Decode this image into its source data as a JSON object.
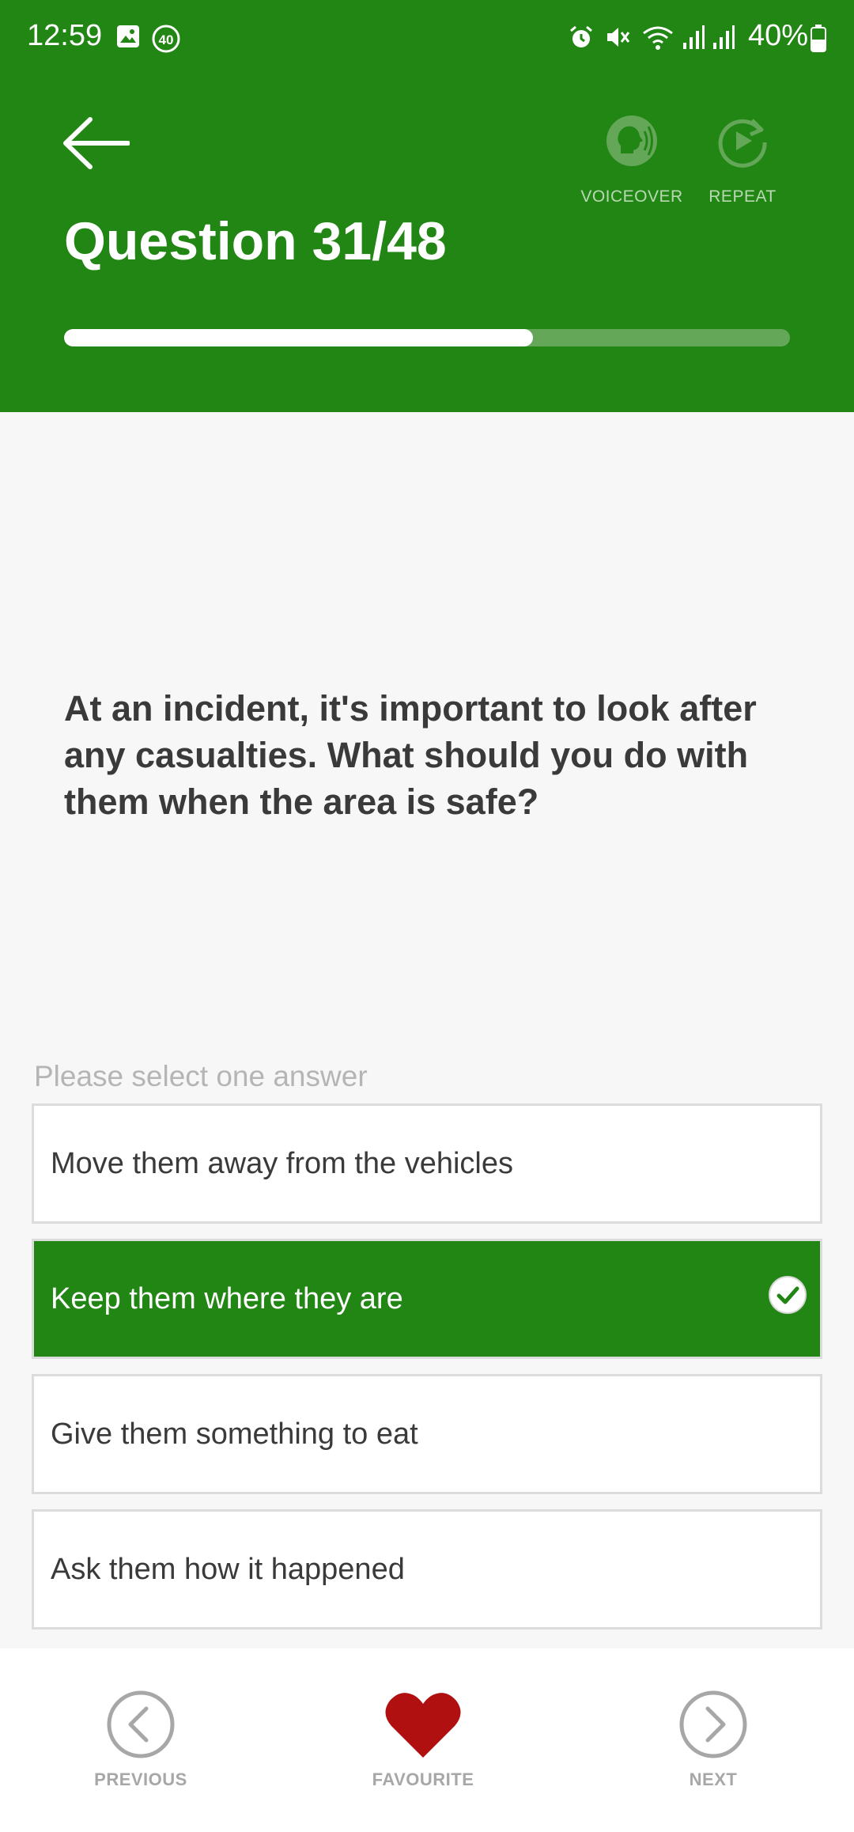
{
  "status_bar": {
    "time": "12:59",
    "battery": "40%"
  },
  "header": {
    "title": "Question 31/48",
    "voiceover_label": "VOICEOVER",
    "repeat_label": "REPEAT",
    "progress": {
      "current": 31,
      "total": 48
    }
  },
  "question": {
    "text": "At an incident, it's important to look after any casualties. What should you do with them when the area is safe?"
  },
  "prompt": "Please select one answer",
  "answers": [
    {
      "label": "Move them away from the vehicles",
      "selected": false
    },
    {
      "label": "Keep them where they are",
      "selected": true
    },
    {
      "label": "Give them something to eat",
      "selected": false
    },
    {
      "label": "Ask them how it happened",
      "selected": false
    }
  ],
  "bottom_nav": {
    "previous": "PREVIOUS",
    "favourite": "FAVOURITE",
    "next": "NEXT"
  },
  "colors": {
    "brand_green": "#228614",
    "favourite_red": "#b01010",
    "progress_track": "#64a758"
  },
  "icons": [
    "image-icon",
    "notification-badge-icon",
    "alarm-icon",
    "mute-icon",
    "wifi-icon",
    "signal-icon",
    "battery-icon",
    "back-arrow-icon",
    "voiceover-icon",
    "repeat-icon",
    "check-icon",
    "chevron-left-icon",
    "heart-icon",
    "chevron-right-icon"
  ]
}
